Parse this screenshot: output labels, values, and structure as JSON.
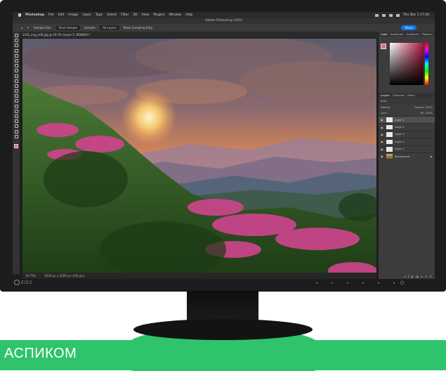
{
  "menubar": {
    "items": [
      "Photoshop",
      "File",
      "Edit",
      "Image",
      "Layer",
      "Type",
      "Select",
      "Filter",
      "3D",
      "View",
      "Plugins",
      "Window",
      "Help"
    ],
    "clock": "Thu Dec 1 17:44"
  },
  "app": {
    "title": "Adobe Photoshop 2023"
  },
  "options": {
    "sample_size_label": "Sample Size:",
    "sample_size_value": "Point Sample",
    "sample_label": "Sample:",
    "sample_value": "All Layers",
    "show_ring": "Show Sampling Ring",
    "share_label": "Share"
  },
  "document": {
    "tab": "1331_img_edit.jpg @ 19.7% (Layer 5, RGB/8#) *"
  },
  "status": {
    "zoom": "19.79%",
    "doc_size": "4928 px x 3280 px (300 ppi)"
  },
  "panels": {
    "color_tabs": [
      "Color",
      "Swatches",
      "Gradients",
      "Patterns"
    ],
    "layer_tabs": [
      "Layers",
      "Channels",
      "Paths"
    ],
    "filter_label": "Kind",
    "blend_mode": "Normal",
    "opacity_label": "Opacity: 100%",
    "lock_label": "Lock:",
    "fill_label": "Fill: 100%",
    "layers": [
      {
        "name": "Layer 5",
        "selected": true
      },
      {
        "name": "Layer 4",
        "selected": false
      },
      {
        "name": "Layer 3",
        "selected": false
      },
      {
        "name": "Layer 2",
        "selected": false
      },
      {
        "name": "Layer 1",
        "selected": false
      },
      {
        "name": "Background",
        "selected": false
      }
    ]
  },
  "colors": {
    "foreground": "#e86a82",
    "banner": "#2fc46b",
    "accent": "#1473e6"
  },
  "monitor": {
    "brand": "EIZO"
  },
  "banner": {
    "text": "АСПИКОМ"
  }
}
